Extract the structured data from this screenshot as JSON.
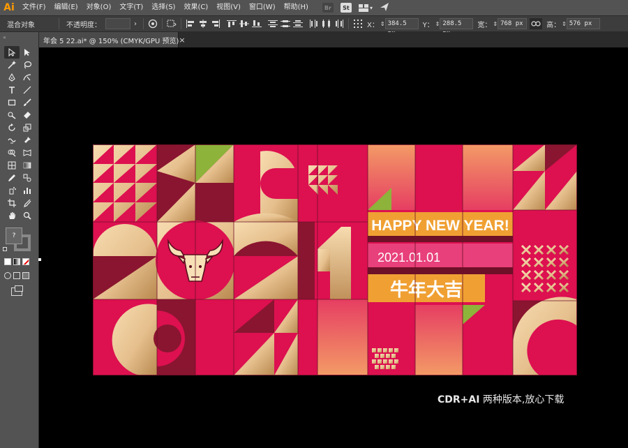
{
  "app": {
    "logo": "Ai",
    "accent": "#ff9a00"
  },
  "menu": {
    "items": [
      "文件(F)",
      "编辑(E)",
      "对象(O)",
      "文字(T)",
      "选择(S)",
      "效果(C)",
      "视图(V)",
      "窗口(W)",
      "帮助(H)"
    ],
    "icons": [
      "Br",
      "St"
    ]
  },
  "controlbar": {
    "object_type": "混合对象",
    "opacity_label": "不透明度：",
    "x_label": "X：",
    "x_value": "384.5 px",
    "y_label": "Y：",
    "y_value": "288.5 px",
    "width_label": "宽：",
    "width_value": "768 px",
    "height_label": "高：",
    "height_value": "576 px"
  },
  "document": {
    "tab_label": "年会 5 22.ai* @ 150% (CMYK/GPU 预览)",
    "close": "×"
  },
  "artwork": {
    "headline": "HAPPY NEW YEAR!",
    "date": "2021.01.01",
    "chinese": "牛年大吉",
    "colors": {
      "red": "#dd1050",
      "maroon": "#8a1530",
      "gold_light": "#f3d2a2",
      "gold_dark": "#c99b63",
      "green": "#8db33a",
      "orange": "#f0a033",
      "pink": "#e8407a"
    }
  },
  "caption": {
    "bold": "CDR+AI",
    "text": " 两种版本,放心下载"
  },
  "tools": {
    "swatch_question": "?"
  }
}
